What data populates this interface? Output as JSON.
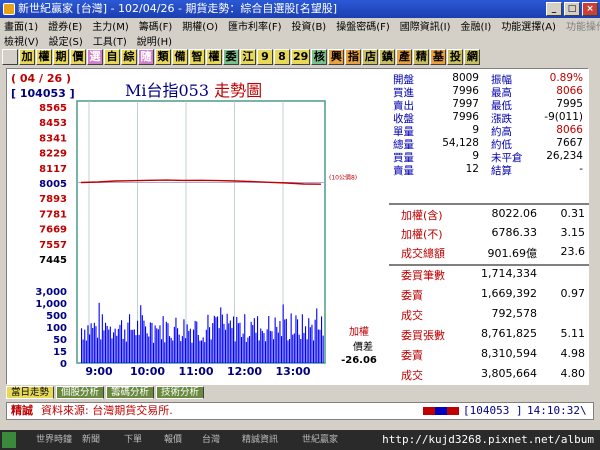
{
  "window": {
    "title": "新世紀贏家 [台灣] - 102/04/26 - 期貨走勢：綜合自選股[名望股]"
  },
  "menu": {
    "row1": [
      "畫面(1)",
      "證券(E)",
      "主力(M)",
      "籌碼(F)",
      "期權(O)",
      "匯市利率(F)",
      "投資(B)",
      "操盤密碼(F)",
      "國際資訊(I)",
      "金融(I)",
      "功能選擇(A)",
      "功能操作(F)"
    ],
    "row2": [
      "檢視(V)",
      "設定(S)",
      "工具(T)",
      "說明(H)"
    ]
  },
  "toolbar": [
    "",
    "加",
    "權",
    "期",
    "價",
    "選",
    "自",
    "綜",
    "隨",
    "類",
    "備",
    "智",
    "權",
    "委",
    "江",
    "9",
    "8",
    "29",
    "核",
    "興",
    "指",
    "店",
    "鎮",
    "產",
    "精",
    "基",
    "投",
    "網"
  ],
  "chart": {
    "date": "( 04 / 26 )",
    "code": "[ 104053 ]",
    "title_prefix": "Mi台指053",
    "title_suffix": "走勢圖",
    "price_labels": [
      "8565",
      "8453",
      "8341",
      "8229",
      "8117",
      "8005",
      "7893",
      "7781",
      "7669",
      "7557",
      "7445"
    ],
    "volume_labels": [
      "3,000",
      "1,000",
      "500",
      "100",
      "50",
      "15",
      "0"
    ],
    "time_labels": [
      "9:00",
      "10:00",
      "11:00",
      "12:00",
      "13:00"
    ],
    "ref_label": "(10公價8)",
    "side_label_1": "加權",
    "side_label_2": "價差",
    "side_value": "-26.06"
  },
  "chart_data": {
    "type": "line",
    "title": "Mi台指053 走勢圖",
    "x": [
      "9:00",
      "10:00",
      "11:00",
      "12:00",
      "13:00"
    ],
    "ylim": [
      7445,
      8565
    ],
    "series": [
      {
        "values": [
          8009,
          8012,
          8020,
          8022,
          8025,
          8026,
          8024,
          8025,
          8023,
          8020,
          8015,
          8010,
          8005,
          7998,
          7996
        ]
      }
    ],
    "volume_ylim": [
      0,
      3000
    ]
  },
  "quote": {
    "rows": [
      {
        "l1": "開盤",
        "v1": "8009",
        "l2": "振幅",
        "v2": "0.89%"
      },
      {
        "l1": "買進",
        "v1": "7996",
        "l2": "最高",
        "v2": "8066"
      },
      {
        "l1": "賣出",
        "v1": "7997",
        "l2": "最低",
        "v2": "7995"
      },
      {
        "l1": "收盤",
        "v1": "7996",
        "l2": "漲跌",
        "v2": "-9(011)"
      },
      {
        "l1": "單量",
        "v1": "9",
        "l2": "約高",
        "v2": "8066"
      },
      {
        "l1": "總量",
        "v1": "54,128",
        "l2": "約低",
        "v2": "7667"
      },
      {
        "l1": "買量",
        "v1": "9",
        "l2": "未平倉",
        "v2": "26,234"
      },
      {
        "l1": "賣量",
        "v1": "12",
        "l2": "結算",
        "v2": "-"
      }
    ],
    "index_rows": [
      {
        "label": "加權(含)",
        "value": "8022.06",
        "pct": "0.31"
      },
      {
        "label": "加權(不)",
        "value": "6786.33",
        "pct": "3.15"
      },
      {
        "label": "成交總額",
        "value": "901.69億",
        "pct": "23.6"
      }
    ],
    "order_rows": [
      {
        "label": "委買筆數",
        "value": "1,714,334",
        "pct": ""
      },
      {
        "label": "委賣",
        "value": "1,669,392",
        "pct": "0.97"
      },
      {
        "label": "成交",
        "value": "792,578",
        "pct": ""
      },
      {
        "label": "委買張數",
        "value": "8,761,825",
        "pct": "5.11"
      },
      {
        "label": "委賣",
        "value": "8,310,594",
        "pct": "4.98"
      },
      {
        "label": "成交",
        "value": "3,805,664",
        "pct": "4.80"
      }
    ]
  },
  "tabs": [
    "當日走勢",
    "個股分析",
    "籌碼分析",
    "技術分析"
  ],
  "status": {
    "tag": "精誠",
    "source": "資料來源: 台灣期貨交易所.",
    "code": "[104053 ]",
    "time": "14:10:32\\"
  },
  "taskbar": {
    "tasks": [
      "世界時鐘",
      "新聞",
      "下單",
      "報價",
      "台灣",
      "精誠資訊",
      "世紀贏家"
    ],
    "watermark": "http://kujd3268.pixnet.net/album"
  },
  "colors": {
    "price_line": "#c00000",
    "volume_bar": "#0000ff",
    "frame": "#4a9a8a",
    "label_red": "#c00000",
    "label_blue": "#0000b0"
  }
}
